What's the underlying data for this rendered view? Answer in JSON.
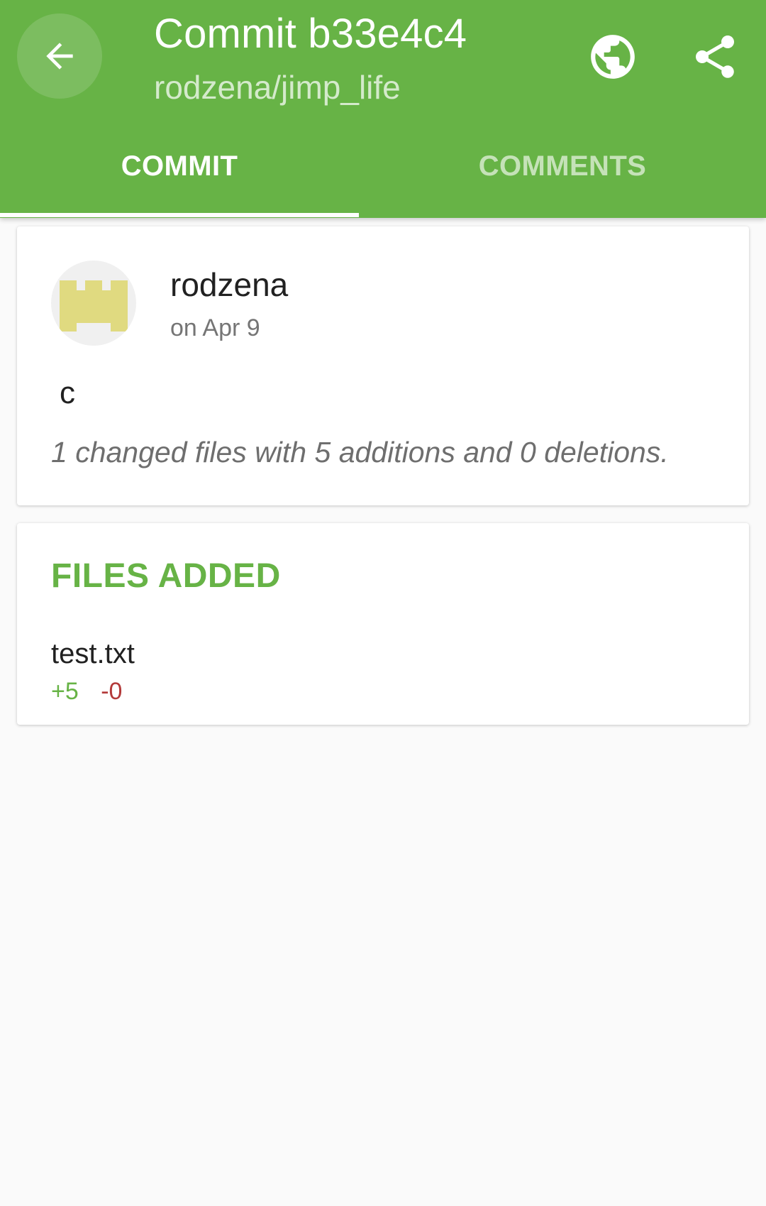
{
  "header": {
    "title": "Commit b33e4c4",
    "subtitle": "rodzena/jimp_life",
    "back_icon": "arrow-back-icon",
    "browser_icon": "globe-icon",
    "share_icon": "share-icon"
  },
  "tabs": [
    {
      "label": "COMMIT",
      "active": true
    },
    {
      "label": "COMMENTS",
      "active": false
    }
  ],
  "commit": {
    "author": "rodzena",
    "date": "on Apr 9",
    "message": "c",
    "summary": "1 changed files with 5 additions and 0 deletions.",
    "avatar_color": "#e0da80"
  },
  "files_section": {
    "title": "FILES ADDED",
    "files": [
      {
        "name": "test.txt",
        "additions": "+5",
        "deletions": "-0"
      }
    ]
  },
  "colors": {
    "primary": "#67b346",
    "addition": "#67b346",
    "deletion": "#b33a3a",
    "background": "#fafafa"
  }
}
